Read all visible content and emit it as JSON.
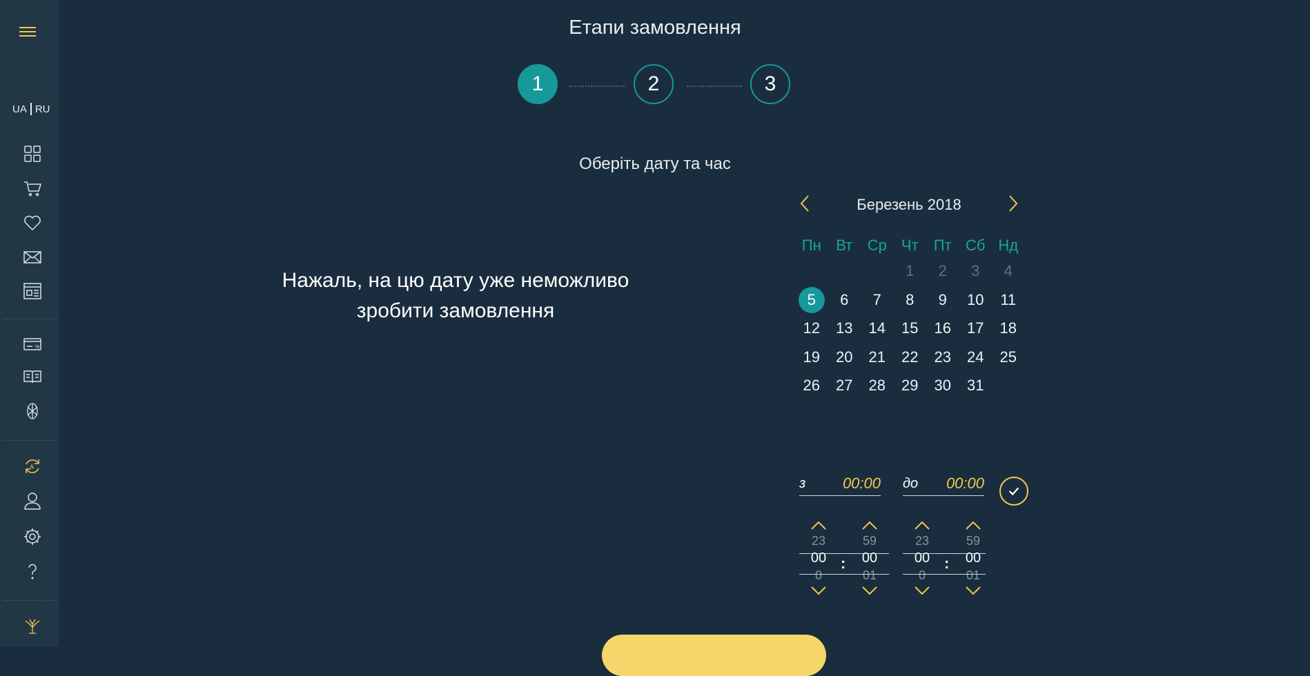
{
  "sidebar": {
    "lang_ua": "UA",
    "lang_ru": "RU",
    "items": [
      {
        "icon": "grid-icon"
      },
      {
        "icon": "cart-icon"
      },
      {
        "icon": "heart-icon"
      },
      {
        "icon": "mail-icon"
      },
      {
        "icon": "news-icon"
      },
      {
        "icon": "discount-card-icon"
      },
      {
        "icon": "book-icon"
      },
      {
        "icon": "flower-icon"
      },
      {
        "icon": "auto-refresh-icon"
      },
      {
        "icon": "user-icon"
      },
      {
        "icon": "settings-icon"
      },
      {
        "icon": "help-icon"
      },
      {
        "icon": "tree-logo-icon"
      }
    ],
    "accent_color": "#f2c94c"
  },
  "header": {
    "title": "Етапи замовлення",
    "steps": [
      "1",
      "2",
      "3"
    ],
    "active_step": "1"
  },
  "content": {
    "subtitle": "Оберіть дату та час",
    "message_line1": "Нажаль, на цю дату уже неможливо",
    "message_line2": "зробити замовлення"
  },
  "calendar": {
    "month_label": "Березень 2018",
    "weekdays": [
      "Пн",
      "Вт",
      "Ср",
      "Чт",
      "Пт",
      "Сб",
      "Нд"
    ],
    "weeks": [
      [
        "",
        "",
        "",
        "1",
        "2",
        "3",
        "4"
      ],
      [
        "5",
        "6",
        "7",
        "8",
        "9",
        "10",
        "11"
      ],
      [
        "12",
        "13",
        "14",
        "15",
        "16",
        "17",
        "18"
      ],
      [
        "19",
        "20",
        "21",
        "22",
        "23",
        "24",
        "25"
      ],
      [
        "26",
        "27",
        "28",
        "29",
        "30",
        "31",
        ""
      ]
    ],
    "muted_days": [
      "1",
      "2",
      "3",
      "4"
    ],
    "selected_day": "5",
    "accent_color": "#17999a"
  },
  "time": {
    "from_label": "з",
    "from_value": "00:00",
    "to_label": "до",
    "to_value": "00:00",
    "pickers": [
      {
        "hour_prev": "23",
        "hour_current": "00",
        "hour_next": "0",
        "minute_prev": "59",
        "minute_current": "00",
        "minute_next": "01"
      },
      {
        "hour_prev": "23",
        "hour_current": "00",
        "hour_next": "0",
        "minute_prev": "59",
        "minute_current": "00",
        "minute_next": "01"
      }
    ],
    "colon": ":",
    "accent_color": "#f2c94c"
  }
}
